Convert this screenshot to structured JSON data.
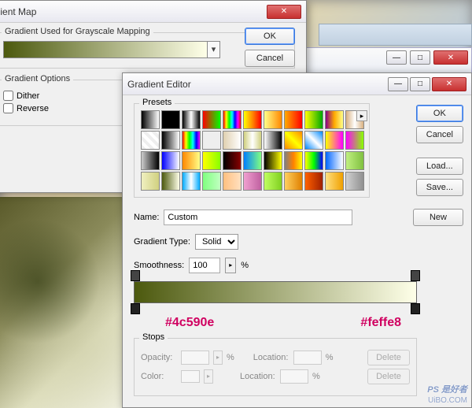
{
  "gmap": {
    "title": "adient Map",
    "section_label": "Gradient Used for Grayscale Mapping",
    "options_label": "Gradient Options",
    "dither_label": "Dither",
    "reverse_label": "Reverse",
    "ok_label": "OK",
    "cancel_label": "Cancel"
  },
  "ged": {
    "title": "Gradient Editor",
    "presets_label": "Presets",
    "name_label": "Name:",
    "name_value": "Custom",
    "gradient_type_label": "Gradient Type:",
    "gradient_type_value": "Solid",
    "smoothness_label": "Smoothness:",
    "smoothness_value": "100",
    "smoothness_unit": "%",
    "ok_label": "OK",
    "cancel_label": "Cancel",
    "load_label": "Load...",
    "save_label": "Save...",
    "new_label": "New",
    "stops_label": "Stops",
    "opacity_label": "Opacity:",
    "location_label": "Location:",
    "color_label": "Color:",
    "delete_label": "Delete",
    "percent": "%",
    "hex_left": "#4c590e",
    "hex_right": "#feffe8"
  },
  "watermark": {
    "logo": "PS 是好者",
    "url": "UiBO.COM"
  },
  "preset_gradients": [
    "linear-gradient(90deg,#000,#fff)",
    "linear-gradient(90deg,#000,#000)",
    "linear-gradient(90deg,#000,#fff,#000)",
    "linear-gradient(90deg,#f00,#0f0)",
    "linear-gradient(90deg,#f00,#ff0,#0f0,#0ff,#00f,#f0f,#f00)",
    "linear-gradient(90deg,#ff0,#f80,#f00)",
    "linear-gradient(90deg,#ff8,#f80)",
    "linear-gradient(90deg,#fa0,#f00)",
    "linear-gradient(90deg,#ff0,#0a0)",
    "linear-gradient(90deg,#808,#fa0,#ff8)",
    "linear-gradient(90deg,#d8b080,#fff,#d8b080)",
    "repeating-linear-gradient(45deg,#eee 0 4px,#fff 4px 8px)",
    "linear-gradient(90deg,#000,#fff)",
    "linear-gradient(90deg,#f00,#ff0,#0f0,#0ff,#00f,#f0f)",
    "linear-gradient(90deg,#eee,#eee)",
    "linear-gradient(90deg,#e0d0b0,#fff)",
    "linear-gradient(90deg,#d0d080,#fff,#d0d080)",
    "linear-gradient(90deg,#fff,#000)",
    "linear-gradient(45deg,#f80,#ff0,#f80)",
    "linear-gradient(45deg,#08f,#fff,#08f)",
    "linear-gradient(90deg,#ff0,#f0f)",
    "linear-gradient(90deg,#f0f,#8f0)",
    "linear-gradient(90deg,#ccc,#000)",
    "linear-gradient(90deg,#00f,#fff)",
    "linear-gradient(90deg,#f80,#ff8)",
    "linear-gradient(90deg,#ff0,#8f0)",
    "linear-gradient(90deg,#000,#800)",
    "linear-gradient(90deg,#0080ff,#80ff80)",
    "linear-gradient(90deg,#000,#ff0)",
    "linear-gradient(90deg,#808080,#ff8000,#ffff00)",
    "linear-gradient(90deg,#ff0,#0f0,#00f)",
    "linear-gradient(90deg,#0066ff,#ffffff)",
    "linear-gradient(90deg,#c0f080,#80c040)",
    "linear-gradient(90deg,#f0f0c0,#d0d080)",
    "linear-gradient(90deg,#4c590e,#feffe8)",
    "linear-gradient(90deg,#00aaff,#ffffff,#00aaff)",
    "linear-gradient(90deg,#80ff80,#c0ffc0)",
    "linear-gradient(90deg,#ffc080,#ffe0c0)",
    "linear-gradient(90deg,#f0a0d0,#c060a0)",
    "linear-gradient(90deg,#c0ff60,#80d020)",
    "linear-gradient(90deg,#ffd060,#e08000)",
    "linear-gradient(90deg,#ff6000,#a02000)",
    "linear-gradient(90deg,#ffe080,#f0a000)",
    "linear-gradient(90deg,#d0d0d0,#909090)"
  ]
}
